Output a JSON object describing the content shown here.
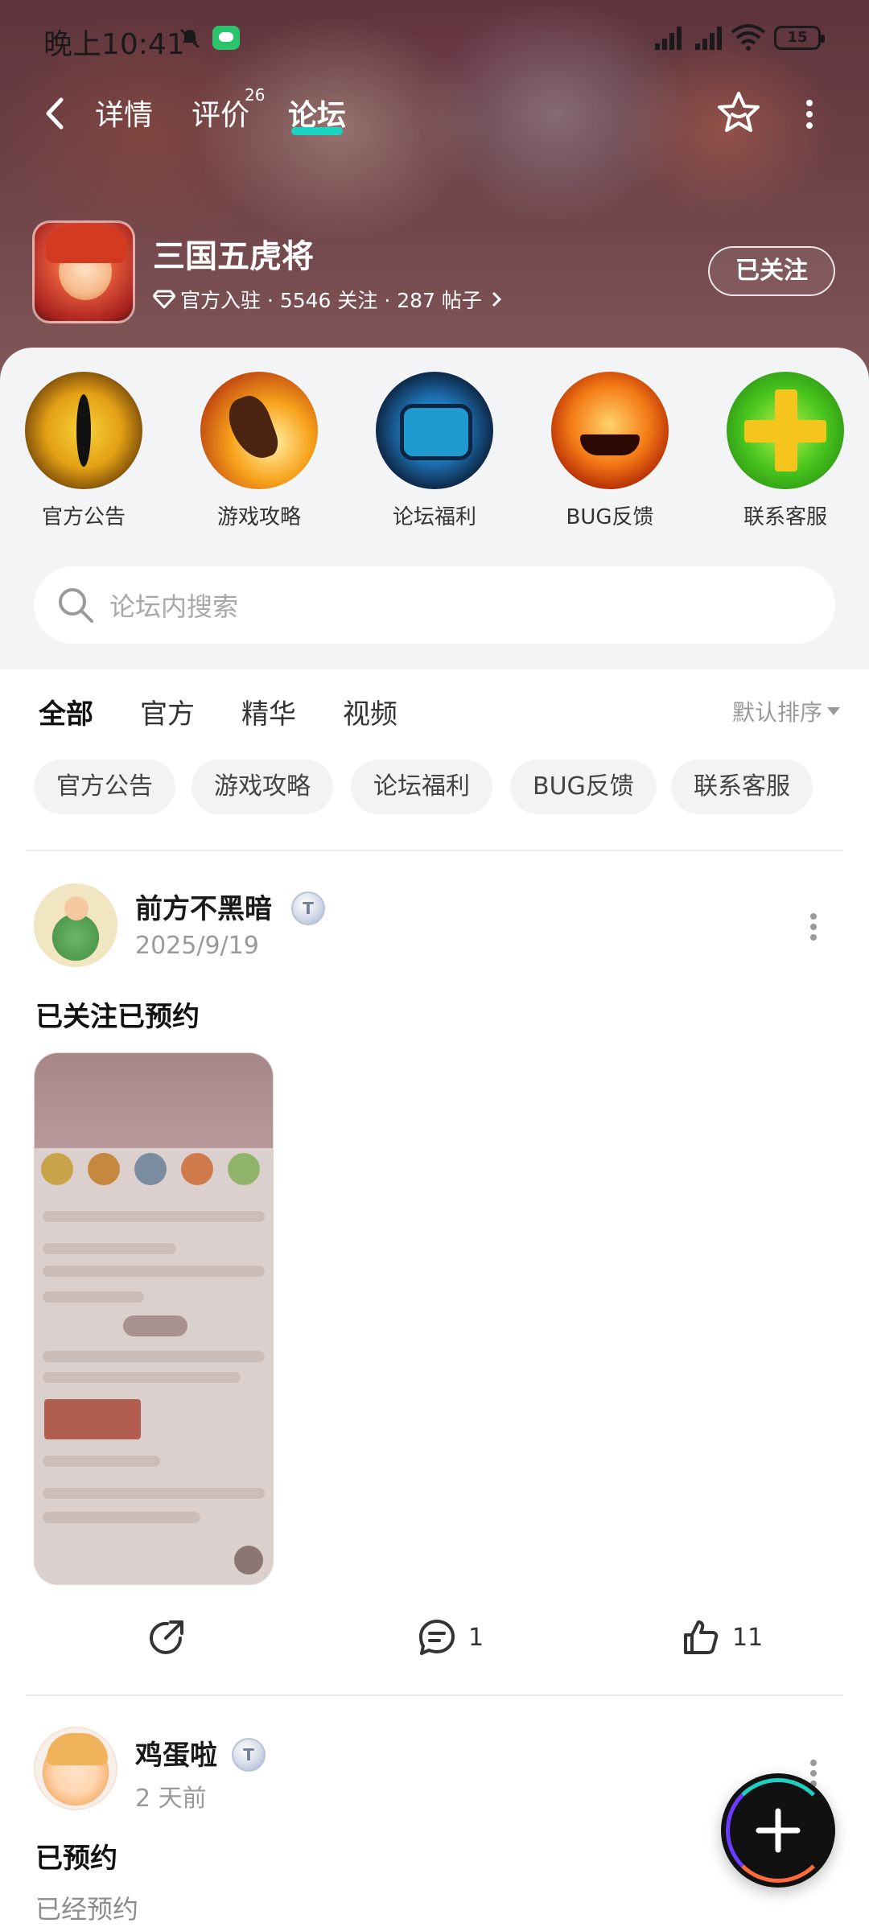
{
  "status_bar": {
    "time": "晚上10:41",
    "battery": "15"
  },
  "nav": {
    "tabs": [
      {
        "label": "详情"
      },
      {
        "label": "评价",
        "count": "26"
      },
      {
        "label": "论坛"
      }
    ],
    "active_tab": "论坛"
  },
  "game": {
    "title": "三国五虎将",
    "meta": "官方入驻 · 5546 关注 · 287 帖子",
    "follow_label": "已关注"
  },
  "categories": [
    {
      "label": "官方公告",
      "icon": "eye-icon"
    },
    {
      "label": "游戏攻略",
      "icon": "guide-icon"
    },
    {
      "label": "论坛福利",
      "icon": "gift-icon"
    },
    {
      "label": "BUG反馈",
      "icon": "pumpkin-icon"
    },
    {
      "label": "联系客服",
      "icon": "plus-icon"
    }
  ],
  "search": {
    "placeholder": "论坛内搜索"
  },
  "filter_tabs": [
    "全部",
    "官方",
    "精华",
    "视频"
  ],
  "active_filter": "全部",
  "sort_label": "默认排序",
  "chips": [
    "官方公告",
    "游戏攻略",
    "论坛福利",
    "BUG反馈",
    "联系客服"
  ],
  "posts": [
    {
      "username": "前方不黑暗",
      "level": "T",
      "date": "2025/9/19",
      "title": "已关注已预约",
      "has_image": true,
      "comments": "1",
      "likes": "11"
    },
    {
      "username": "鸡蛋啦",
      "level": "T",
      "date": "2 天前",
      "title": "已预约",
      "body": "已经预约"
    }
  ],
  "colors": {
    "accent": "#19d3c0",
    "panel_bg": "#f3f4f6",
    "chip_bg": "#f2f3f5"
  }
}
